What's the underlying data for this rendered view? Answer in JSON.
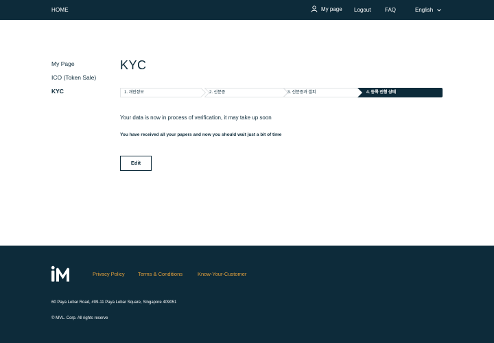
{
  "header": {
    "home": "HOME",
    "my_page": "My page",
    "logout": "Logout",
    "faq": "FAQ",
    "language": "English"
  },
  "sidebar": {
    "items": [
      {
        "label": "My Page",
        "active": false
      },
      {
        "label": "ICO (Token Sale)",
        "active": false
      },
      {
        "label": "KYC",
        "active": true
      }
    ]
  },
  "main": {
    "title": "KYC",
    "steps": [
      {
        "label": "1. 개인정보",
        "active": false
      },
      {
        "label": "2. 신분증",
        "active": false
      },
      {
        "label": "3. 신분증과 셀피",
        "active": false
      },
      {
        "label": "4. 등록 진행 상태",
        "active": true
      }
    ],
    "status_message": "Your data is now in process of verification, it may take up soon",
    "sub_message": "You have received all your papers and now you should wait just a bit of time",
    "edit_label": "Edit"
  },
  "footer": {
    "links": [
      "Privacy Policy",
      "Terms & Conditions",
      "Know-Your-Customer"
    ],
    "address": "60 Paya Lebar Road, #09-11 Paya Lebar Square, Singapore 409051",
    "copyright": "© MVL. Corp. All rights reserve"
  },
  "colors": {
    "navy": "#0d2b3a",
    "accent": "#e3a03b",
    "white": "#ffffff"
  },
  "icons": [
    "user-icon",
    "chevron-down-icon",
    "mvl-logo"
  ]
}
